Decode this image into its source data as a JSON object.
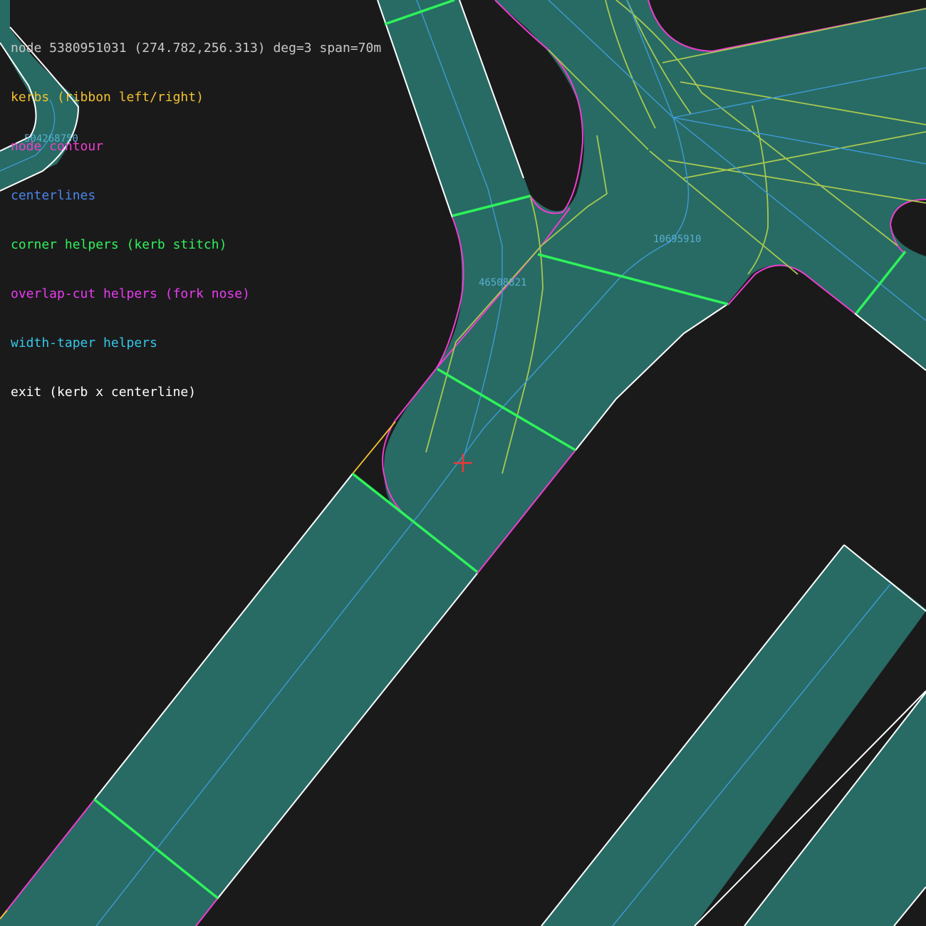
{
  "header": {
    "info": "node 5380951031 (274.782,256.313) deg=3 span=70m",
    "color": "#c8c8c8"
  },
  "legend": {
    "items": [
      {
        "label": "kerbs (ribbon left/right)",
        "color": "#f2c230"
      },
      {
        "label": "node contour",
        "color": "#ee3fd0"
      },
      {
        "label": "centerlines",
        "color": "#4a86e8"
      },
      {
        "label": "corner helpers (kerb stitch)",
        "color": "#2ef25a"
      },
      {
        "label": "overlap-cut helpers (fork nose)",
        "color": "#e83cf0"
      },
      {
        "label": "width-taper helpers",
        "color": "#35c8e8"
      },
      {
        "label": "exit (kerb x centerline)",
        "color": "#ffffff"
      }
    ]
  },
  "way_labels": {
    "way_a": "46508821",
    "way_b": "10695910",
    "way_c": "504268750"
  },
  "colors": {
    "background": "#1b1a1b",
    "road_fill": "#276b64",
    "road_outline": "#ffffff",
    "centerline": "#3f9ad6",
    "corner_helper": "#2ef25a",
    "node_contour": "#ee3fd0",
    "kerb": "#f2c230",
    "taper": "#a8c850",
    "node_marker": "#e83a3a"
  }
}
